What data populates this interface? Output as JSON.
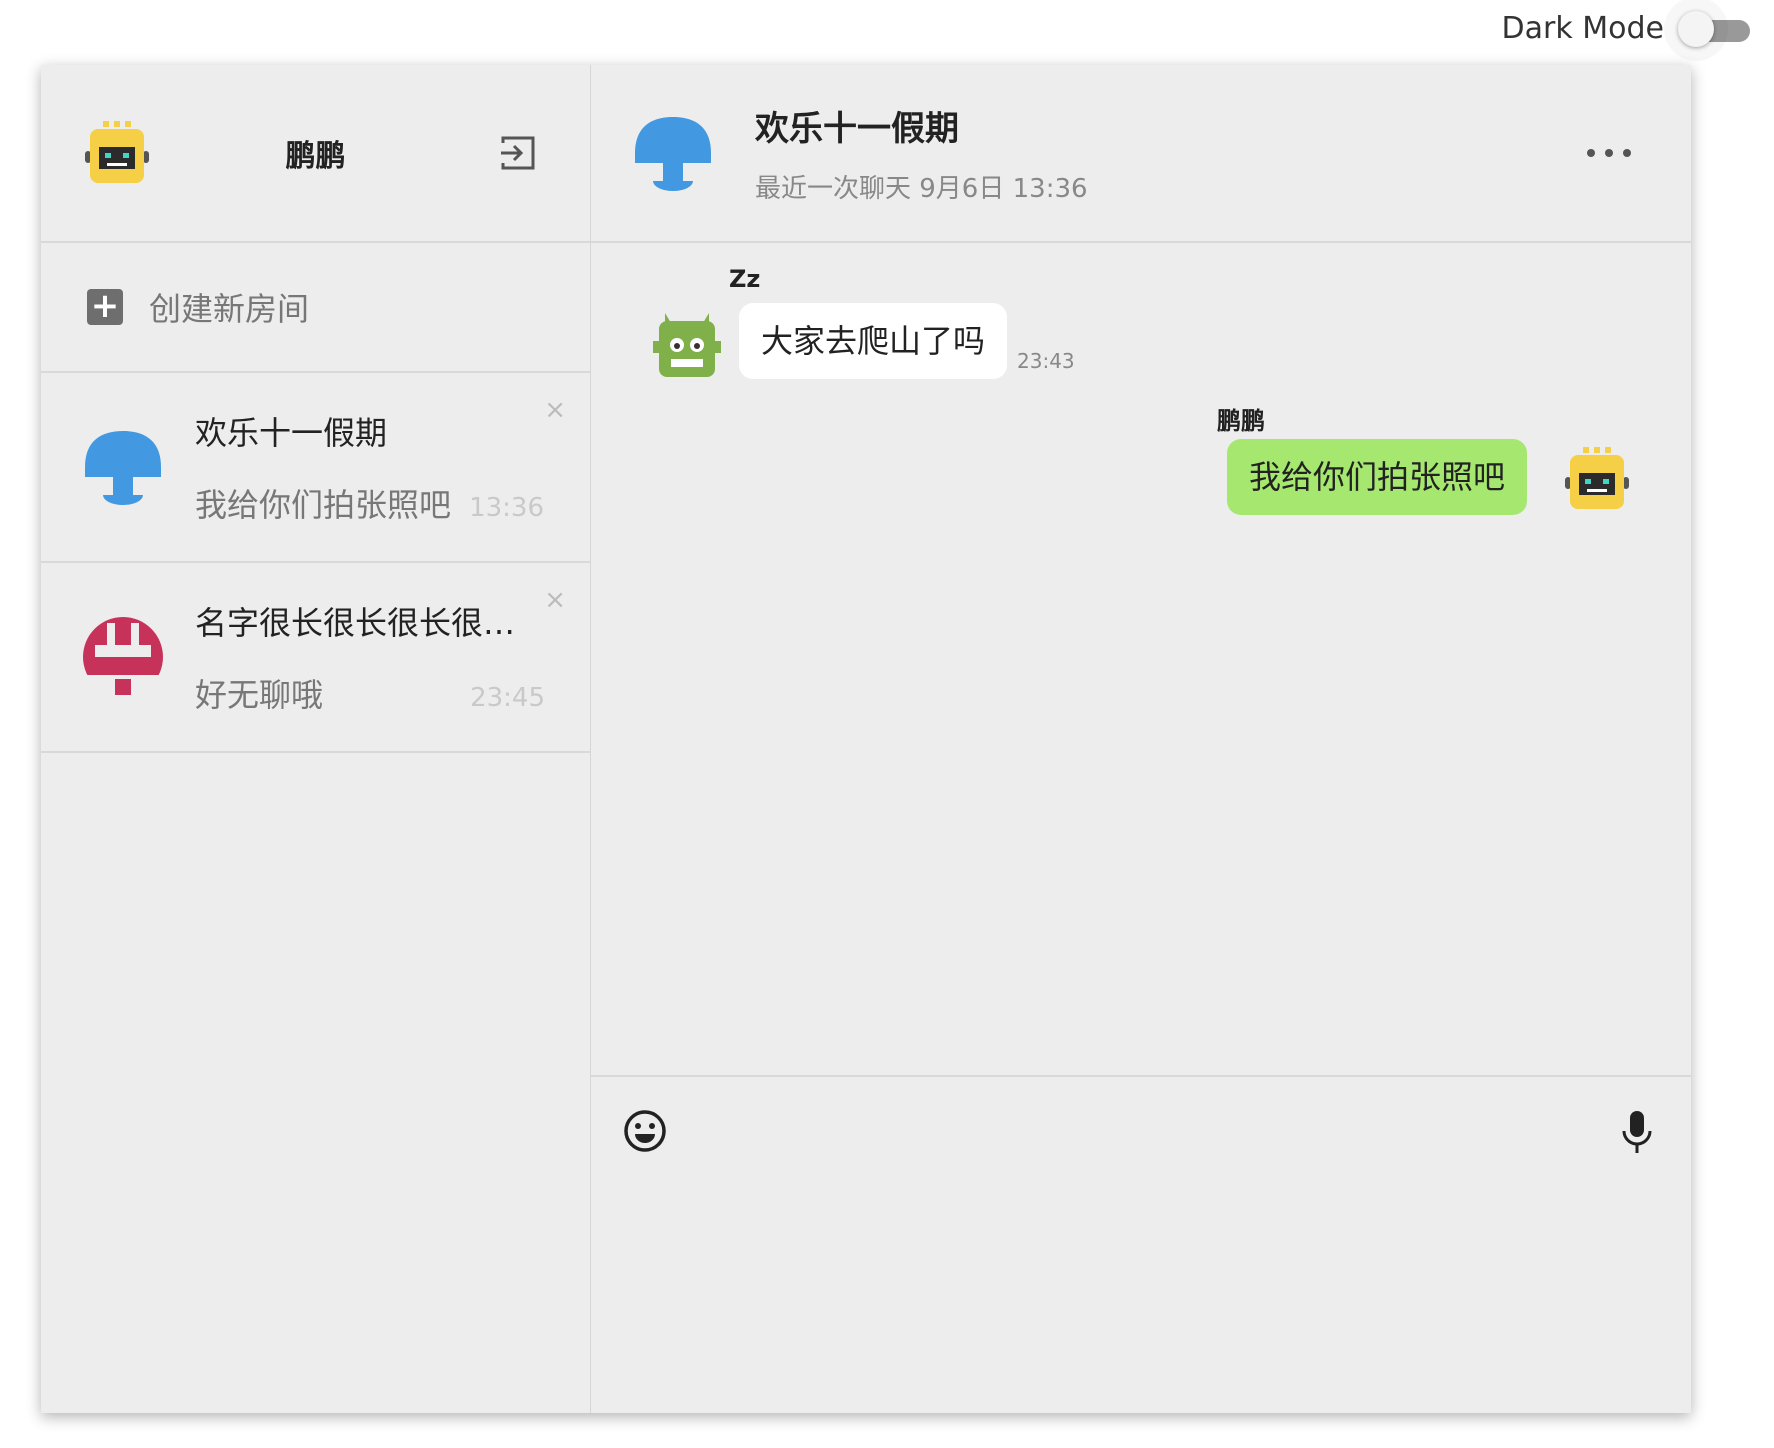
{
  "dark_mode": {
    "label": "Dark Mode",
    "enabled": false
  },
  "user": {
    "name": "鹏鹏"
  },
  "sidebar": {
    "new_room_label": "创建新房间",
    "rooms": [
      {
        "title": "欢乐十一假期",
        "last_message": "我给你们拍张照吧",
        "time": "13:36",
        "close": "×"
      },
      {
        "title": "名字很长很长很长很长...",
        "last_message": "好无聊哦",
        "time": "23:45",
        "close": "×"
      }
    ]
  },
  "chat": {
    "title": "欢乐十一假期",
    "subtitle": "最近一次聊天 9月6日 13:36",
    "messages": [
      {
        "sender": "Zz",
        "text": "大家去爬山了吗",
        "time": "23:43",
        "direction": "incoming"
      },
      {
        "sender": "鹏鹏",
        "text": "我给你们拍张照吧",
        "direction": "outgoing"
      }
    ],
    "input_placeholder": ""
  },
  "colors": {
    "outgoing_bubble": "#a6e86f",
    "incoming_bubble": "#ffffff",
    "room_avatar_blue": "#4299e1",
    "room_avatar_red": "#c7325b",
    "user_avatar_yellow": "#f5cf45",
    "zz_avatar_green": "#7fb04a"
  }
}
